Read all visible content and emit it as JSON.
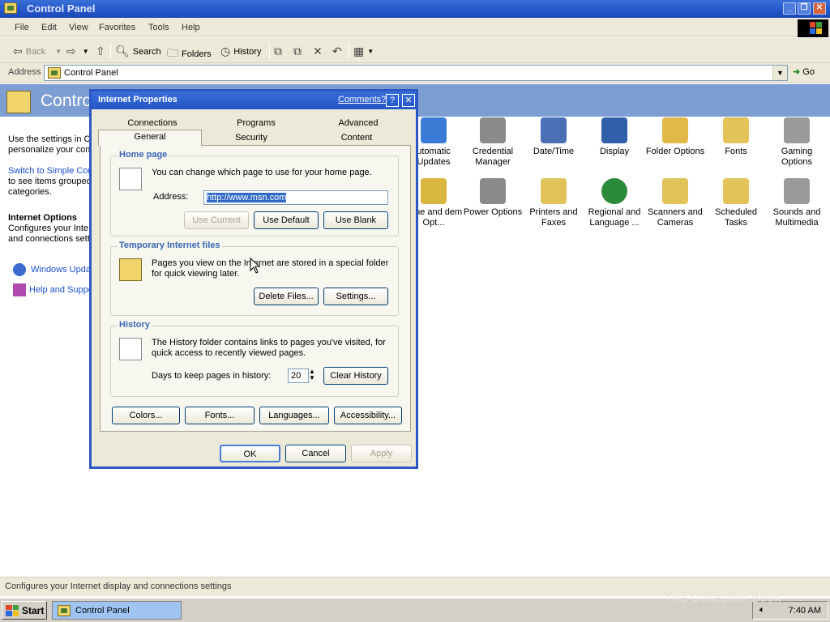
{
  "window": {
    "title": "Control Panel",
    "buttons": {
      "minimize": "_",
      "restore": "❐",
      "close": "✕"
    }
  },
  "menubar": {
    "items": [
      "File",
      "Edit",
      "View",
      "Favorites",
      "Tools",
      "Help"
    ]
  },
  "toolbar": {
    "back": "Back",
    "search": "Search",
    "folders": "Folders",
    "history": "History"
  },
  "addressbar": {
    "label": "Address",
    "value": "Control Panel",
    "go": "Go"
  },
  "control_panel": {
    "header_title": "Control Panel",
    "left_pane": {
      "intro_line1": "Use the settings in C",
      "intro_line2": "personalize your com",
      "switch_link_line1": "Switch to Simple Con",
      "switch_line2": "to see items grouped",
      "switch_line3": "categories.",
      "selected_title": "Internet Options",
      "selected_desc1": "Configures your Inte",
      "selected_desc2": "and connections setti",
      "windows_update": "Windows Upda",
      "help_support": "Help and Suppo"
    },
    "items_row1": [
      {
        "label": "utomatic Updates",
        "color": "#3a7bd5"
      },
      {
        "label": "Credential Manager",
        "color": "#8a8a8a"
      },
      {
        "label": "Date/Time",
        "color": "#4a6fb5"
      },
      {
        "label": "Display",
        "color": "#2f5fa8"
      },
      {
        "label": "Folder Options",
        "color": "#e2b84a"
      },
      {
        "label": "Fonts",
        "color": "#e2c35a"
      },
      {
        "label": "Gaming Options",
        "color": "#9a9a9a"
      }
    ],
    "items_row2": [
      {
        "label": "hone and dem Opt...",
        "color": "#d8b640"
      },
      {
        "label": "Power Options",
        "color": "#8a8a8a"
      },
      {
        "label": "Printers and Faxes",
        "color": "#e2c35a"
      },
      {
        "label": "Regional and Language ...",
        "color": "#2a8a3a"
      },
      {
        "label": "Scanners and Cameras",
        "color": "#e2c35a"
      },
      {
        "label": "Scheduled Tasks",
        "color": "#e2c35a"
      },
      {
        "label": "Sounds and Multimedia",
        "color": "#9a9a9a"
      }
    ]
  },
  "dialog": {
    "title": "Internet Properties",
    "comments": "Comments?",
    "help": "?",
    "close": "✕",
    "tabs_top": [
      "Connections",
      "Programs",
      "Advanced"
    ],
    "tabs_bottom": [
      "General",
      "Security",
      "Content"
    ],
    "homepage": {
      "title": "Home page",
      "description": "You can change which page to use for your home page.",
      "address_label": "Address:",
      "address_value": "http://www.msn.com",
      "use_current": "Use Current",
      "use_default": "Use Default",
      "use_blank": "Use Blank"
    },
    "temp_files": {
      "title": "Temporary Internet files",
      "line1": "Pages you view on the Internet are stored in a special folder",
      "line2": "for quick viewing later.",
      "delete_files": "Delete Files...",
      "settings": "Settings..."
    },
    "history": {
      "title": "History",
      "line1": "The History folder contains links to pages you've visited, for",
      "line2": "quick access to recently viewed pages.",
      "days_label": "Days to keep pages in history:",
      "days_value": "20",
      "clear_history": "Clear History"
    },
    "bottom_buttons": [
      "Colors...",
      "Fonts...",
      "Languages...",
      "Accessibility..."
    ],
    "ok": "OK",
    "cancel": "Cancel",
    "apply": "Apply"
  },
  "statusbar": {
    "text": "Configures your Internet display and connections settings"
  },
  "taskbar": {
    "start": "Start",
    "task": "Control Panel",
    "clock": "7:40 AM"
  },
  "watermark": "The Collection Book"
}
